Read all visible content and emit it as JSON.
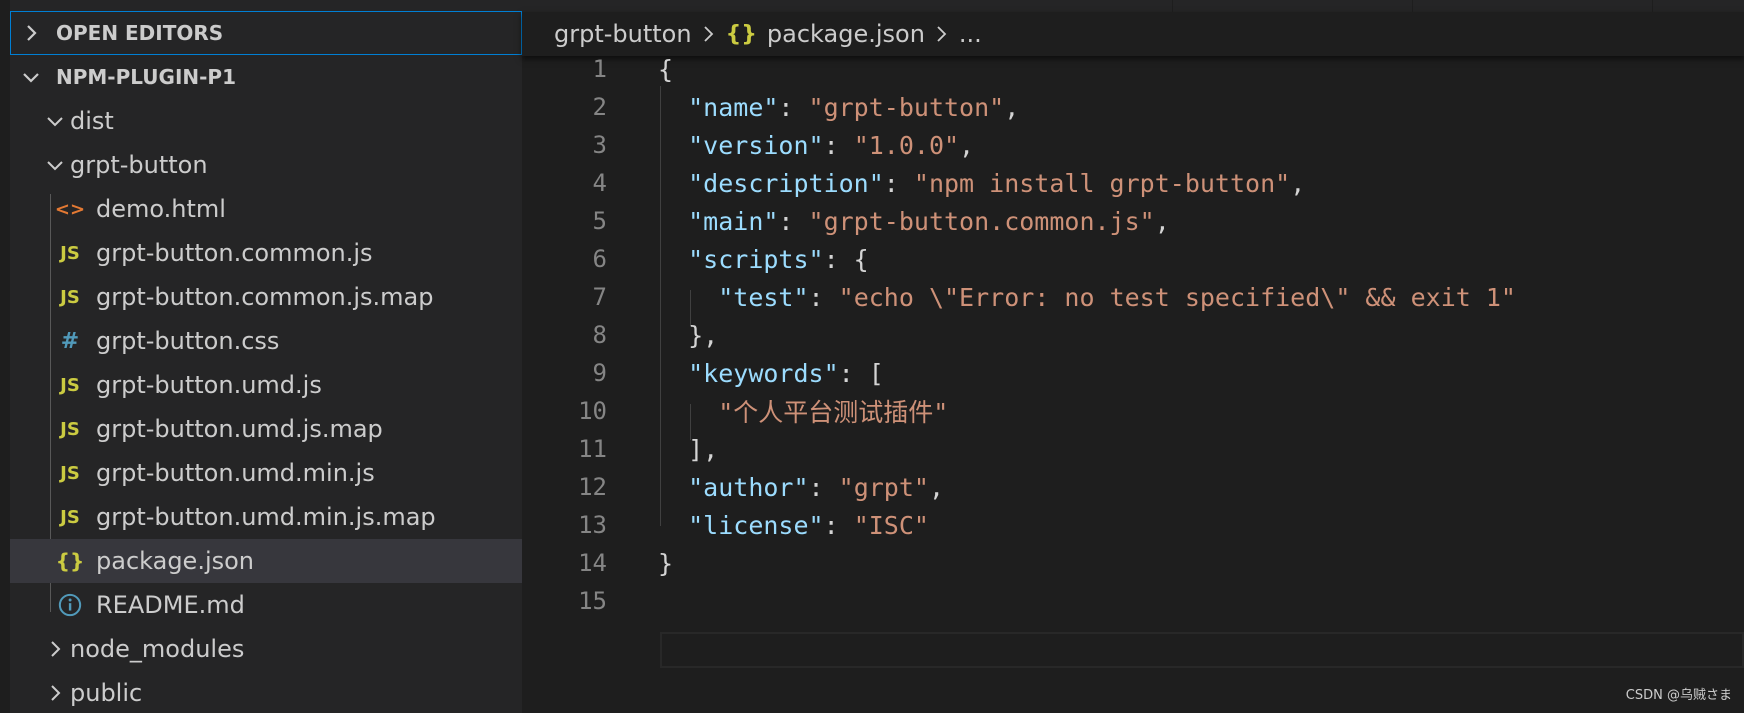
{
  "sidebar": {
    "open_editors_label": "OPEN EDITORS",
    "project_label": "NPM-PLUGIN-P1",
    "items": [
      {
        "label": "dist",
        "icon_text": "",
        "icon_color": ""
      },
      {
        "label": "grpt-button",
        "icon_text": "",
        "icon_color": ""
      },
      {
        "label": "demo.html",
        "icon_text": "<>",
        "icon_color": "#e37933"
      },
      {
        "label": "grpt-button.common.js",
        "icon_text": "JS",
        "icon_color": "#cbcb41"
      },
      {
        "label": "grpt-button.common.js.map",
        "icon_text": "JS",
        "icon_color": "#cbcb41"
      },
      {
        "label": "grpt-button.css",
        "icon_text": "#",
        "icon_color": "#519aba"
      },
      {
        "label": "grpt-button.umd.js",
        "icon_text": "JS",
        "icon_color": "#cbcb41"
      },
      {
        "label": "grpt-button.umd.js.map",
        "icon_text": "JS",
        "icon_color": "#cbcb41"
      },
      {
        "label": "grpt-button.umd.min.js",
        "icon_text": "JS",
        "icon_color": "#cbcb41"
      },
      {
        "label": "grpt-button.umd.min.js.map",
        "icon_text": "JS",
        "icon_color": "#cbcb41"
      },
      {
        "label": "package.json",
        "icon_text": "{}",
        "icon_color": "#cbcb41"
      },
      {
        "label": "README.md",
        "icon_text": "i",
        "icon_color": "#519aba"
      },
      {
        "label": "node_modules",
        "icon_text": "",
        "icon_color": ""
      },
      {
        "label": "public",
        "icon_text": "",
        "icon_color": ""
      }
    ]
  },
  "breadcrumb": {
    "folder": "grpt-button",
    "json_icon": "{}",
    "file": "package.json",
    "more": "..."
  },
  "editor": {
    "line_numbers": [
      "1",
      "2",
      "3",
      "4",
      "5",
      "6",
      "7",
      "8",
      "9",
      "10",
      "11",
      "12",
      "13",
      "14",
      "15"
    ],
    "lines": [
      [
        {
          "t": "p",
          "v": "{"
        }
      ],
      [
        {
          "t": "p",
          "v": "  "
        },
        {
          "t": "k",
          "v": "\"name\""
        },
        {
          "t": "p",
          "v": ": "
        },
        {
          "t": "s",
          "v": "\"grpt-button\""
        },
        {
          "t": "p",
          "v": ","
        }
      ],
      [
        {
          "t": "p",
          "v": "  "
        },
        {
          "t": "k",
          "v": "\"version\""
        },
        {
          "t": "p",
          "v": ": "
        },
        {
          "t": "s",
          "v": "\"1.0.0\""
        },
        {
          "t": "p",
          "v": ","
        }
      ],
      [
        {
          "t": "p",
          "v": "  "
        },
        {
          "t": "k",
          "v": "\"description\""
        },
        {
          "t": "p",
          "v": ": "
        },
        {
          "t": "s",
          "v": "\"npm install grpt-button\""
        },
        {
          "t": "p",
          "v": ","
        }
      ],
      [
        {
          "t": "p",
          "v": "  "
        },
        {
          "t": "k",
          "v": "\"main\""
        },
        {
          "t": "p",
          "v": ": "
        },
        {
          "t": "s",
          "v": "\"grpt-button.common.js\""
        },
        {
          "t": "p",
          "v": ","
        }
      ],
      [
        {
          "t": "p",
          "v": "  "
        },
        {
          "t": "k",
          "v": "\"scripts\""
        },
        {
          "t": "p",
          "v": ": {"
        }
      ],
      [
        {
          "t": "p",
          "v": "    "
        },
        {
          "t": "k",
          "v": "\"test\""
        },
        {
          "t": "p",
          "v": ": "
        },
        {
          "t": "s",
          "v": "\"echo \\\"Error: no test specified\\\" && exit 1\""
        }
      ],
      [
        {
          "t": "p",
          "v": "  },"
        }
      ],
      [
        {
          "t": "p",
          "v": "  "
        },
        {
          "t": "k",
          "v": "\"keywords\""
        },
        {
          "t": "p",
          "v": ": ["
        }
      ],
      [
        {
          "t": "p",
          "v": "    "
        },
        {
          "t": "s",
          "v": "\"个人平台测试插件\""
        }
      ],
      [
        {
          "t": "p",
          "v": "  ],"
        }
      ],
      [
        {
          "t": "p",
          "v": "  "
        },
        {
          "t": "k",
          "v": "\"author\""
        },
        {
          "t": "p",
          "v": ": "
        },
        {
          "t": "s",
          "v": "\"grpt\""
        },
        {
          "t": "p",
          "v": ","
        }
      ],
      [
        {
          "t": "p",
          "v": "  "
        },
        {
          "t": "k",
          "v": "\"license\""
        },
        {
          "t": "p",
          "v": ": "
        },
        {
          "t": "s",
          "v": "\"ISC\""
        }
      ],
      [
        {
          "t": "p",
          "v": "}"
        }
      ],
      []
    ]
  },
  "watermark": "CSDN @乌贼さま",
  "colors": {
    "key": "#9cdcfe",
    "string": "#ce9178",
    "focus_border": "#007fd4",
    "selected_row": "#37373d"
  }
}
